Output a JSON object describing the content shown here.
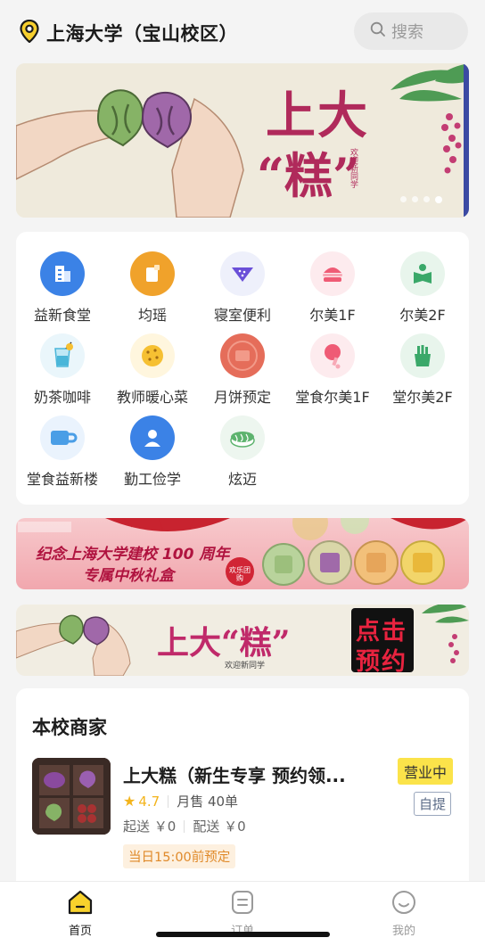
{
  "header": {
    "location": "上海大学（宝山校区）",
    "search_placeholder": "搜索"
  },
  "banner_main": {
    "title_line1": "上大",
    "title_line2": "“糕”",
    "subtitle": "欢迎新同学",
    "page_count": 4,
    "active_page": 4
  },
  "categories": [
    {
      "label": "益新食堂",
      "icon": "building-icon",
      "color": "#3b82e6"
    },
    {
      "label": "均瑶",
      "icon": "cup-icon",
      "color": "#f0a22b"
    },
    {
      "label": "寝室便利",
      "icon": "watermelon-icon",
      "color": "#6a4fd8"
    },
    {
      "label": "尔美1F",
      "icon": "burger-icon",
      "color": "#ef5b75"
    },
    {
      "label": "尔美2F",
      "icon": "reading-icon",
      "color": "#3aa869"
    },
    {
      "label": "奶茶咖啡",
      "icon": "drink-icon",
      "color": "#4ab6d9"
    },
    {
      "label": "教师暖心菜",
      "icon": "cookie-icon",
      "color": "#f6c032"
    },
    {
      "label": "月饼预定",
      "icon": "mooncake-icon",
      "color": "#e56d5a"
    },
    {
      "label": "堂食尔美1F",
      "icon": "drumstick-icon",
      "color": "#ef5b75"
    },
    {
      "label": "堂尔美2F",
      "icon": "fries-icon",
      "color": "#3aa869"
    },
    {
      "label": "堂食益新楼",
      "icon": "mug-icon",
      "color": "#4a9ee6"
    },
    {
      "label": "勤工俭学",
      "icon": "person-icon",
      "color": "#3b82e6"
    },
    {
      "label": "炫迈",
      "icon": "sushi-icon",
      "color": "#5db36e"
    }
  ],
  "banner_promo": {
    "line1": "纪念上海大学建校 100 周年",
    "line2": "专属中秋礼盒",
    "badge": "欢乐团购"
  },
  "banner_cake": {
    "title": "上大“糕”",
    "subtitle": "欢迎新同学",
    "cta_line1": "点击",
    "cta_line2": "预约"
  },
  "merchants_section": {
    "title": "本校商家",
    "items": [
      {
        "name": "上大糕（新生专享 预约领...",
        "status": "营业中",
        "pickup": "自提",
        "rating": "4.7",
        "monthly_sales": "月售 40单",
        "min_order": "起送 ￥0",
        "delivery_fee": "配送 ￥0",
        "tag": "当日15:00前预定"
      }
    ]
  },
  "bottom_nav": {
    "items": [
      {
        "label": "首页",
        "icon": "home-icon",
        "active": true
      },
      {
        "label": "订单",
        "icon": "order-icon",
        "active": false
      },
      {
        "label": "我的",
        "icon": "profile-icon",
        "active": false
      }
    ]
  },
  "colors": {
    "accent_yellow": "#fbe34a",
    "brand_red": "#b02a5b",
    "rating_star": "#f3b41c"
  }
}
